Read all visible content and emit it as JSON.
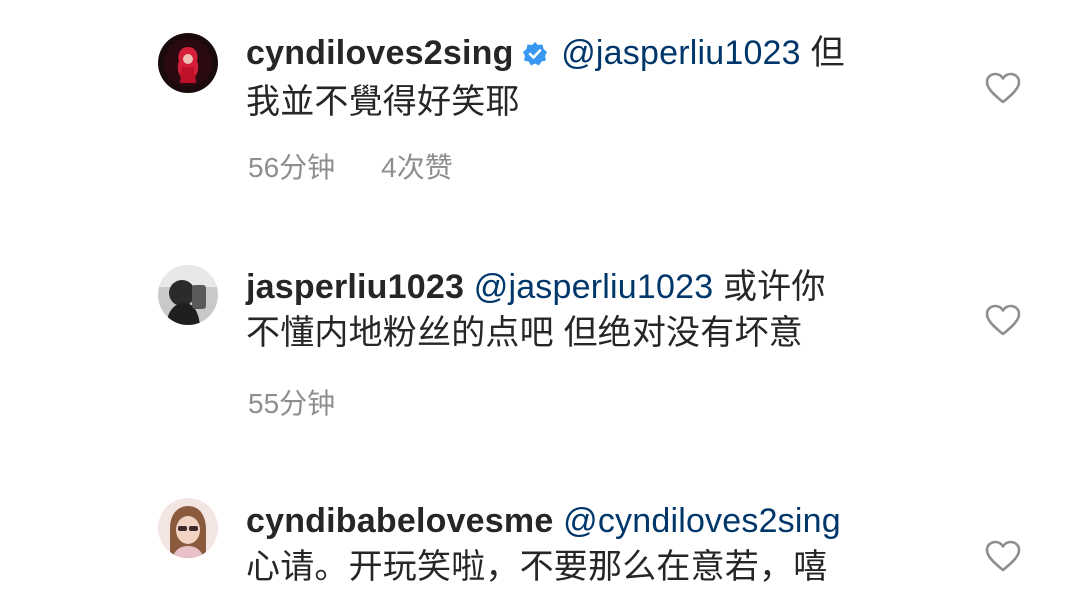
{
  "comments": [
    {
      "username": "cyndiloves2sing",
      "verified": true,
      "mention": "@jasperliu1023",
      "text_inline": "但",
      "text_line2": "我並不覺得好笑耶",
      "time": "56分钟",
      "likes": "4次赞"
    },
    {
      "username": "jasperliu1023",
      "verified": false,
      "mention": "@jasperliu1023",
      "text_inline": "或许你",
      "text_line2": "不懂内地粉丝的点吧 但绝对没有坏意",
      "time": "55分钟"
    },
    {
      "username": "cyndibabelovesme",
      "verified": false,
      "mention": "@cyndiloves2sing",
      "text_line2": "心请。开玩笑啦，不要那么在意若，嘻"
    }
  ],
  "icons": {
    "verified_color": "#3897f0",
    "heart": "heart-outline-icon"
  }
}
